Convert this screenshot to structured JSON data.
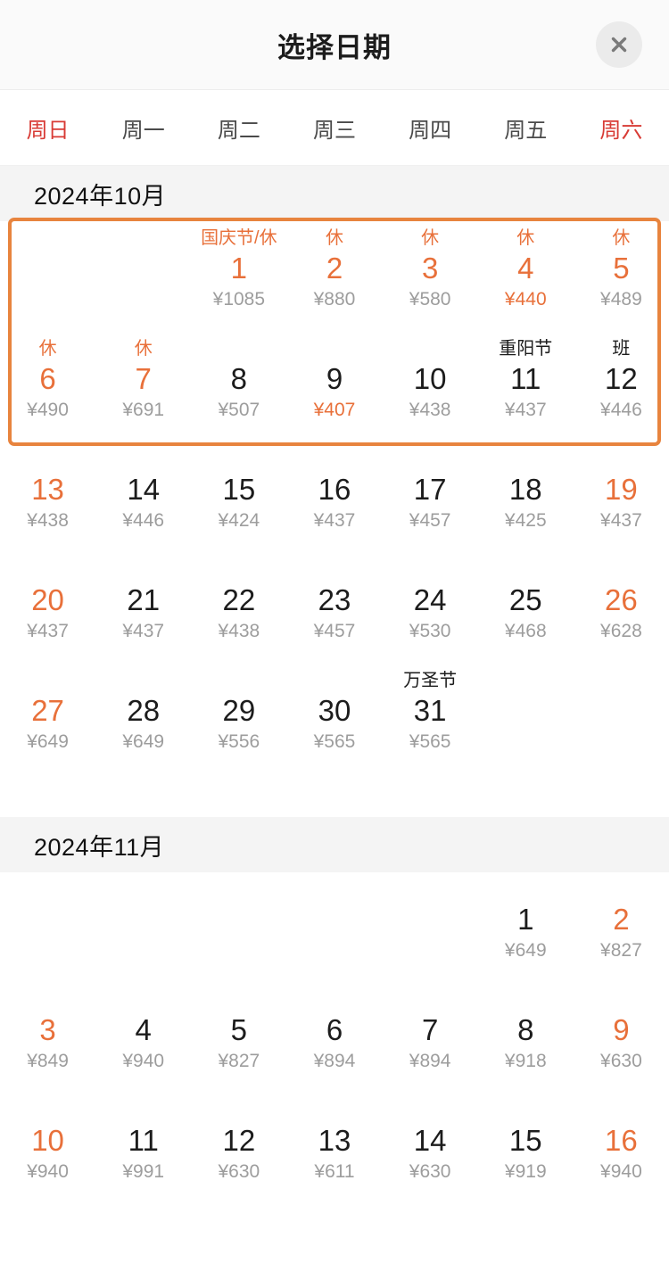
{
  "header": {
    "title": "选择日期",
    "close_icon": "close-icon"
  },
  "weekdays": [
    {
      "label": "周日",
      "weekend": true
    },
    {
      "label": "周一",
      "weekend": false
    },
    {
      "label": "周二",
      "weekend": false
    },
    {
      "label": "周三",
      "weekend": false
    },
    {
      "label": "周四",
      "weekend": false
    },
    {
      "label": "周五",
      "weekend": false
    },
    {
      "label": "周六",
      "weekend": true
    }
  ],
  "currency_symbol": "¥",
  "colors": {
    "accent_orange": "#e8703a",
    "highlight_border": "#e8843e",
    "weekend_red": "#d83b35",
    "price_gray": "#9d9d9d",
    "band_gray": "#f4f4f4",
    "header_bg": "#fafafa"
  },
  "months": [
    {
      "title": "2024年10月",
      "highlight_weeks": [
        0,
        1
      ],
      "weeks": [
        [
          {
            "empty": true
          },
          {
            "empty": true
          },
          {
            "day": "1",
            "label": "国庆节/休",
            "label_style": "orange",
            "price": "¥1085",
            "day_style": "orange",
            "price_style": "gray"
          },
          {
            "day": "2",
            "label": "休",
            "label_style": "orange",
            "price": "¥880",
            "day_style": "orange",
            "price_style": "gray"
          },
          {
            "day": "3",
            "label": "休",
            "label_style": "orange",
            "price": "¥580",
            "day_style": "orange",
            "price_style": "gray"
          },
          {
            "day": "4",
            "label": "休",
            "label_style": "orange",
            "price": "¥440",
            "day_style": "orange",
            "price_style": "orange"
          },
          {
            "day": "5",
            "label": "休",
            "label_style": "orange",
            "price": "¥489",
            "day_style": "orange",
            "price_style": "gray"
          }
        ],
        [
          {
            "day": "6",
            "label": "休",
            "label_style": "orange",
            "price": "¥490",
            "day_style": "orange",
            "price_style": "gray"
          },
          {
            "day": "7",
            "label": "休",
            "label_style": "orange",
            "price": "¥691",
            "day_style": "orange",
            "price_style": "gray"
          },
          {
            "day": "8",
            "label": "",
            "label_style": "blank",
            "price": "¥507",
            "day_style": "dark",
            "price_style": "gray"
          },
          {
            "day": "9",
            "label": "",
            "label_style": "blank",
            "price": "¥407",
            "day_style": "dark",
            "price_style": "orange"
          },
          {
            "day": "10",
            "label": "",
            "label_style": "blank",
            "price": "¥438",
            "day_style": "dark",
            "price_style": "gray"
          },
          {
            "day": "11",
            "label": "重阳节",
            "label_style": "dark",
            "price": "¥437",
            "day_style": "dark",
            "price_style": "gray"
          },
          {
            "day": "12",
            "label": "班",
            "label_style": "dark",
            "price": "¥446",
            "day_style": "dark",
            "price_style": "gray"
          }
        ],
        [
          {
            "day": "13",
            "label": "",
            "label_style": "blank",
            "price": "¥438",
            "day_style": "orange",
            "price_style": "gray"
          },
          {
            "day": "14",
            "label": "",
            "label_style": "blank",
            "price": "¥446",
            "day_style": "dark",
            "price_style": "gray"
          },
          {
            "day": "15",
            "label": "",
            "label_style": "blank",
            "price": "¥424",
            "day_style": "dark",
            "price_style": "gray"
          },
          {
            "day": "16",
            "label": "",
            "label_style": "blank",
            "price": "¥437",
            "day_style": "dark",
            "price_style": "gray"
          },
          {
            "day": "17",
            "label": "",
            "label_style": "blank",
            "price": "¥457",
            "day_style": "dark",
            "price_style": "gray"
          },
          {
            "day": "18",
            "label": "",
            "label_style": "blank",
            "price": "¥425",
            "day_style": "dark",
            "price_style": "gray"
          },
          {
            "day": "19",
            "label": "",
            "label_style": "blank",
            "price": "¥437",
            "day_style": "orange",
            "price_style": "gray"
          }
        ],
        [
          {
            "day": "20",
            "label": "",
            "label_style": "blank",
            "price": "¥437",
            "day_style": "orange",
            "price_style": "gray"
          },
          {
            "day": "21",
            "label": "",
            "label_style": "blank",
            "price": "¥437",
            "day_style": "dark",
            "price_style": "gray"
          },
          {
            "day": "22",
            "label": "",
            "label_style": "blank",
            "price": "¥438",
            "day_style": "dark",
            "price_style": "gray"
          },
          {
            "day": "23",
            "label": "",
            "label_style": "blank",
            "price": "¥457",
            "day_style": "dark",
            "price_style": "gray"
          },
          {
            "day": "24",
            "label": "",
            "label_style": "blank",
            "price": "¥530",
            "day_style": "dark",
            "price_style": "gray"
          },
          {
            "day": "25",
            "label": "",
            "label_style": "blank",
            "price": "¥468",
            "day_style": "dark",
            "price_style": "gray"
          },
          {
            "day": "26",
            "label": "",
            "label_style": "blank",
            "price": "¥628",
            "day_style": "orange",
            "price_style": "gray"
          }
        ],
        [
          {
            "day": "27",
            "label": "",
            "label_style": "blank",
            "price": "¥649",
            "day_style": "orange",
            "price_style": "gray"
          },
          {
            "day": "28",
            "label": "",
            "label_style": "blank",
            "price": "¥649",
            "day_style": "dark",
            "price_style": "gray"
          },
          {
            "day": "29",
            "label": "",
            "label_style": "blank",
            "price": "¥556",
            "day_style": "dark",
            "price_style": "gray"
          },
          {
            "day": "30",
            "label": "",
            "label_style": "blank",
            "price": "¥565",
            "day_style": "dark",
            "price_style": "gray"
          },
          {
            "day": "31",
            "label": "万圣节",
            "label_style": "dark",
            "price": "¥565",
            "day_style": "dark",
            "price_style": "gray"
          },
          {
            "empty": true
          },
          {
            "empty": true
          }
        ]
      ]
    },
    {
      "title": "2024年11月",
      "highlight_weeks": [],
      "weeks": [
        [
          {
            "empty": true
          },
          {
            "empty": true
          },
          {
            "empty": true
          },
          {
            "empty": true
          },
          {
            "empty": true
          },
          {
            "day": "1",
            "label": "",
            "label_style": "blank",
            "price": "¥649",
            "day_style": "dark",
            "price_style": "gray"
          },
          {
            "day": "2",
            "label": "",
            "label_style": "blank",
            "price": "¥827",
            "day_style": "orange",
            "price_style": "gray"
          }
        ],
        [
          {
            "day": "3",
            "label": "",
            "label_style": "blank",
            "price": "¥849",
            "day_style": "orange",
            "price_style": "gray"
          },
          {
            "day": "4",
            "label": "",
            "label_style": "blank",
            "price": "¥940",
            "day_style": "dark",
            "price_style": "gray"
          },
          {
            "day": "5",
            "label": "",
            "label_style": "blank",
            "price": "¥827",
            "day_style": "dark",
            "price_style": "gray"
          },
          {
            "day": "6",
            "label": "",
            "label_style": "blank",
            "price": "¥894",
            "day_style": "dark",
            "price_style": "gray"
          },
          {
            "day": "7",
            "label": "",
            "label_style": "blank",
            "price": "¥894",
            "day_style": "dark",
            "price_style": "gray"
          },
          {
            "day": "8",
            "label": "",
            "label_style": "blank",
            "price": "¥918",
            "day_style": "dark",
            "price_style": "gray"
          },
          {
            "day": "9",
            "label": "",
            "label_style": "blank",
            "price": "¥630",
            "day_style": "orange",
            "price_style": "gray"
          }
        ],
        [
          {
            "day": "10",
            "label": "",
            "label_style": "blank",
            "price": "¥940",
            "day_style": "orange",
            "price_style": "gray"
          },
          {
            "day": "11",
            "label": "",
            "label_style": "blank",
            "price": "¥991",
            "day_style": "dark",
            "price_style": "gray"
          },
          {
            "day": "12",
            "label": "",
            "label_style": "blank",
            "price": "¥630",
            "day_style": "dark",
            "price_style": "gray"
          },
          {
            "day": "13",
            "label": "",
            "label_style": "blank",
            "price": "¥611",
            "day_style": "dark",
            "price_style": "gray"
          },
          {
            "day": "14",
            "label": "",
            "label_style": "blank",
            "price": "¥630",
            "day_style": "dark",
            "price_style": "gray"
          },
          {
            "day": "15",
            "label": "",
            "label_style": "blank",
            "price": "¥919",
            "day_style": "dark",
            "price_style": "gray"
          },
          {
            "day": "16",
            "label": "",
            "label_style": "blank",
            "price": "¥940",
            "day_style": "orange",
            "price_style": "gray"
          }
        ]
      ]
    }
  ]
}
